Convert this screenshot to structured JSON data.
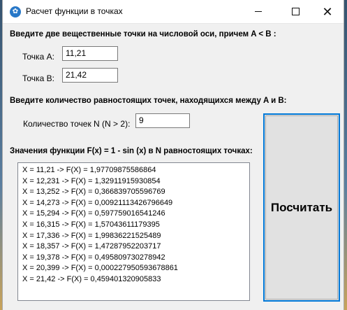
{
  "window": {
    "title": "Расчет функции в точках",
    "controls": {
      "minimize": "—",
      "maximize": "☐",
      "close": "✕"
    }
  },
  "section_points": {
    "heading": "Введите две вещественные точки на числовой оси, причем A < B :",
    "point_a_label": "Точка A:",
    "point_a_value": "11,21",
    "point_b_label": "Точка B:",
    "point_b_value": "21,42"
  },
  "section_count": {
    "heading": "Введите количество равностоящих точек, находящихся между A и B:",
    "count_label": "Количество точек N (N > 2):",
    "count_value": "9"
  },
  "section_results": {
    "heading": "Значения функции F(x) = 1 - sin (x) в N равностоящих точках:",
    "rows": [
      "X  = 11,21 -> F(X) = 1,97709875586864",
      "X  = 12,231 -> F(X) = 1,32911915930854",
      "X  = 13,252 -> F(X) = 0,366839705596769",
      "X  = 14,273 -> F(X) = 0,00921113426796649",
      "X  = 15,294 -> F(X) = 0,597759016541246",
      "X  = 16,315 -> F(X) = 1,57043611179395",
      "X  = 17,336 -> F(X) = 1,99836221525489",
      "X  = 18,357 -> F(X) = 1,47287952203717",
      "X  = 19,378 -> F(X) = 0,495809730278942",
      "X  = 20,399 -> F(X) = 0,000227950593678861",
      "X  = 21,42 -> F(X) = 0,459401320905833"
    ]
  },
  "actions": {
    "calculate_label": "Посчитать"
  },
  "colors": {
    "accent": "#0078d7",
    "window_bg": "#f0f0f0",
    "button_bg": "#e1e1e1"
  }
}
